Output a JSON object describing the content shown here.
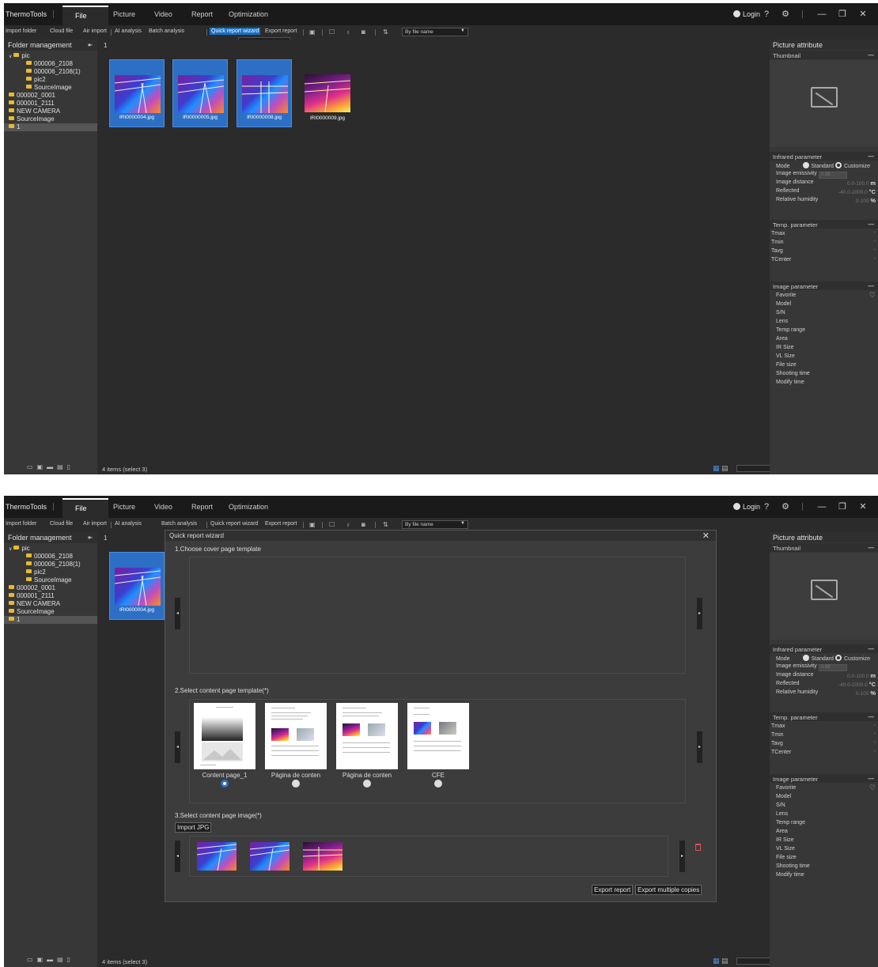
{
  "app": {
    "title": "ThermoTools"
  },
  "menu": {
    "file": "File",
    "picture": "Picture",
    "video": "Video",
    "report": "Report",
    "optimization": "Optimization"
  },
  "login": "Login",
  "toolbar": {
    "import_folder": "Import folder",
    "cloud_file": "Cloud file",
    "air_import": "Air import",
    "ai_analysis": "AI analysis",
    "batch_analysis": "Batch analysis",
    "quick_report_wizard": "Quick report wizard",
    "export_report": "Export report",
    "sort": "By file name"
  },
  "tooltip": "Quick report wizard",
  "folder_panel": {
    "title": "Folder management",
    "tree": [
      "pic",
      "000006_2108",
      "000006_2108(1)",
      "pic2",
      "SourceImage",
      "000002_0001",
      "000001_2111",
      "NEW CAMERA",
      "SourceImage",
      "1"
    ]
  },
  "breadcrumb": "1",
  "images": [
    "IRI0000004.jpg",
    "IRI0000005.jpg",
    "IRI0000008.jpg",
    "IRI0000009.jpg"
  ],
  "status": "4 items (select 3)",
  "right_panel": {
    "title": "Picture attribute",
    "thumbnail": "Thumbnail",
    "infrared_parameter": "Infrared parameter",
    "mode": "Mode",
    "standard": "Standard",
    "customize": "Customize",
    "image_emissivity": "Image emissivity",
    "emissivity_value": "0.98",
    "image_distance": "Image distance",
    "distance_range": "0.0-100.0",
    "distance_unit": "m",
    "reflected": "Reflected",
    "reflected_range": "-40.0-2000.0",
    "reflected_unit": "°C",
    "relative_humidity": "Relative humidity",
    "humidity_range": "0-100",
    "humidity_unit": "%",
    "temp_parameter": "Temp. parameter",
    "temps": [
      "Tmax",
      "Tmin",
      "Tavg",
      "TCenter"
    ],
    "temp_unit": "°",
    "image_parameter": "Image parameter",
    "image_params": [
      "Favorite",
      "Model",
      "S/N",
      "Lens",
      "Temp range",
      "Area",
      "IR Size",
      "VL Size",
      "File size",
      "Shooting time",
      "Modify time"
    ]
  },
  "wizard": {
    "title": "Quick report wizard",
    "step1": "1.Choose cover page template",
    "step2": "2.Select content page template(*)",
    "step3": "3.Select content page image(*)",
    "templates": [
      "Content page_1",
      "Página de conten",
      "Página de conten",
      "CFE"
    ],
    "import_jpg": "Import JPG",
    "export_report": "Export report",
    "export_multiple": "Export multiple copies"
  }
}
